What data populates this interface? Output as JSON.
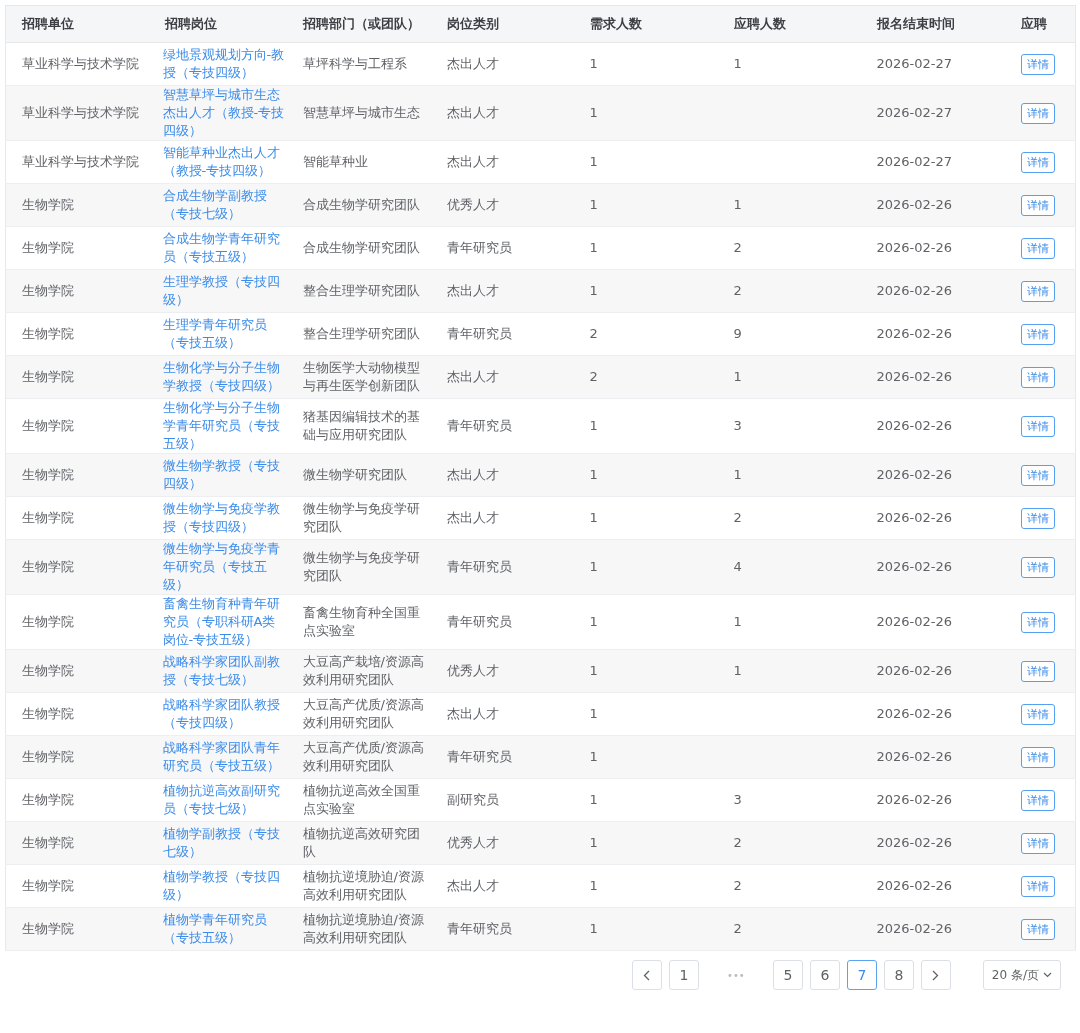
{
  "table": {
    "columns": [
      "招聘单位",
      "招聘岗位",
      "招聘部门（或团队）",
      "岗位类别",
      "需求人数",
      "应聘人数",
      "报名结束时间",
      "应聘"
    ],
    "rows": [
      {
        "unit": "草业科学与技术学院",
        "position": "绿地景观规划方向-教授（专技四级）",
        "department": "草坪科学与工程系",
        "category": "杰出人才",
        "needed": "1",
        "applicants": "1",
        "deadline": "2026-02-27",
        "action": "详情"
      },
      {
        "unit": "草业科学与技术学院",
        "position": "智慧草坪与城市生态杰出人才（教授-专技四级）",
        "department": "智慧草坪与城市生态",
        "category": "杰出人才",
        "needed": "1",
        "deadline": "2026-02-27",
        "action": "详情"
      },
      {
        "unit": "草业科学与技术学院",
        "position": "智能草种业杰出人才（教授-专技四级）",
        "department": "智能草种业",
        "category": "杰出人才",
        "needed": "1",
        "deadline": "2026-02-27",
        "action": "详情"
      },
      {
        "unit": "生物学院",
        "position": "合成生物学副教授（专技七级）",
        "department": "合成生物学研究团队",
        "category": "优秀人才",
        "needed": "1",
        "applicants": "1",
        "deadline": "2026-02-26",
        "action": "详情"
      },
      {
        "unit": "生物学院",
        "position": "合成生物学青年研究员（专技五级）",
        "department": "合成生物学研究团队",
        "category": "青年研究员",
        "needed": "1",
        "applicants": "2",
        "deadline": "2026-02-26",
        "action": "详情"
      },
      {
        "unit": "生物学院",
        "position": "生理学教授（专技四级）",
        "department": "整合生理学研究团队",
        "category": "杰出人才",
        "needed": "1",
        "applicants": "2",
        "deadline": "2026-02-26",
        "action": "详情"
      },
      {
        "unit": "生物学院",
        "position": "生理学青年研究员（专技五级）",
        "department": "整合生理学研究团队",
        "category": "青年研究员",
        "needed": "2",
        "applicants": "9",
        "deadline": "2026-02-26",
        "action": "详情"
      },
      {
        "unit": "生物学院",
        "position": "生物化学与分子生物学教授（专技四级）",
        "department": "生物医学大动物模型与再生医学创新团队",
        "category": "杰出人才",
        "needed": "2",
        "applicants": "1",
        "deadline": "2026-02-26",
        "action": "详情"
      },
      {
        "unit": "生物学院",
        "position": "生物化学与分子生物学青年研究员（专技五级）",
        "department": "猪基因编辑技术的基础与应用研究团队",
        "category": "青年研究员",
        "needed": "1",
        "applicants": "3",
        "deadline": "2026-02-26",
        "action": "详情"
      },
      {
        "unit": "生物学院",
        "position": "微生物学教授（专技四级）",
        "department": "微生物学研究团队",
        "category": "杰出人才",
        "needed": "1",
        "applicants": "1",
        "deadline": "2026-02-26",
        "action": "详情"
      },
      {
        "unit": "生物学院",
        "position": "微生物学与免疫学教授（专技四级）",
        "department": "微生物学与免疫学研究团队",
        "category": "杰出人才",
        "needed": "1",
        "applicants": "2",
        "deadline": "2026-02-26",
        "action": "详情"
      },
      {
        "unit": "生物学院",
        "position": "微生物学与免疫学青年研究员（专技五级）",
        "department": "微生物学与免疫学研究团队",
        "category": "青年研究员",
        "needed": "1",
        "applicants": "4",
        "deadline": "2026-02-26",
        "action": "详情"
      },
      {
        "unit": "生物学院",
        "position": "畜禽生物育种青年研究员（专职科研A类岗位-专技五级）",
        "department": "畜禽生物育种全国重点实验室",
        "category": "青年研究员",
        "needed": "1",
        "applicants": "1",
        "deadline": "2026-02-26",
        "action": "详情"
      },
      {
        "unit": "生物学院",
        "position": "战略科学家团队副教授（专技七级）",
        "department": "大豆高产栽培/资源高效利用研究团队",
        "category": "优秀人才",
        "needed": "1",
        "applicants": "1",
        "deadline": "2026-02-26",
        "action": "详情"
      },
      {
        "unit": "生物学院",
        "position": "战略科学家团队教授（专技四级）",
        "department": "大豆高产优质/资源高效利用研究团队",
        "category": "杰出人才",
        "needed": "1",
        "deadline": "2026-02-26",
        "action": "详情"
      },
      {
        "unit": "生物学院",
        "position": "战略科学家团队青年研究员（专技五级）",
        "department": "大豆高产优质/资源高效利用研究团队",
        "category": "青年研究员",
        "needed": "1",
        "deadline": "2026-02-26",
        "action": "详情"
      },
      {
        "unit": "生物学院",
        "position": "植物抗逆高效副研究员（专技七级）",
        "department": "植物抗逆高效全国重点实验室",
        "category": "副研究员",
        "needed": "1",
        "applicants": "3",
        "deadline": "2026-02-26",
        "action": "详情"
      },
      {
        "unit": "生物学院",
        "position": "植物学副教授（专技七级）",
        "department": "植物抗逆高效研究团队",
        "category": "优秀人才",
        "needed": "1",
        "applicants": "2",
        "deadline": "2026-02-26",
        "action": "详情"
      },
      {
        "unit": "生物学院",
        "position": "植物学教授（专技四级）",
        "department": "植物抗逆境胁迫/资源高效利用研究团队",
        "category": "杰出人才",
        "needed": "1",
        "applicants": "2",
        "deadline": "2026-02-26",
        "action": "详情"
      },
      {
        "unit": "生物学院",
        "position": "植物学青年研究员（专技五级）",
        "department": "植物抗逆境胁迫/资源高效利用研究团队",
        "category": "青年研究员",
        "needed": "1",
        "applicants": "2",
        "deadline": "2026-02-26",
        "action": "详情"
      }
    ]
  },
  "pagination": {
    "items": [
      {
        "kind": "prev",
        "selected": false
      },
      {
        "kind": "page",
        "label": "1",
        "selected": false
      },
      {
        "kind": "ellipsis",
        "label": "•••",
        "selected": false
      },
      {
        "kind": "page",
        "label": "5",
        "selected": false
      },
      {
        "kind": "page",
        "label": "6",
        "selected": false
      },
      {
        "kind": "page",
        "label": "7",
        "selected": true
      },
      {
        "kind": "page",
        "label": "8",
        "selected": false
      },
      {
        "kind": "next",
        "selected": false
      }
    ],
    "page_size": "20 条/页"
  }
}
